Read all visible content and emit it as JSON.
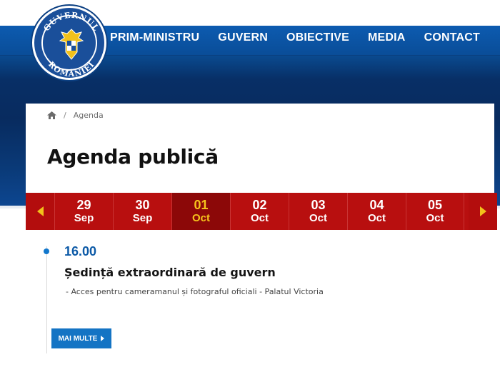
{
  "logo": {
    "ring_top": "GUVERNUL",
    "ring_bottom": "ROMÂNIEI"
  },
  "nav": {
    "items": [
      {
        "label": "PRIM-MINISTRU"
      },
      {
        "label": "GUVERN"
      },
      {
        "label": "OBIECTIVE"
      },
      {
        "label": "MEDIA"
      },
      {
        "label": "CONTACT"
      }
    ]
  },
  "breadcrumb": {
    "separator": "/",
    "current": "Agenda"
  },
  "page": {
    "title": "Agenda publică"
  },
  "dates": {
    "days": [
      {
        "num": "29",
        "mon": "Sep"
      },
      {
        "num": "30",
        "mon": "Sep"
      },
      {
        "num": "01",
        "mon": "Oct"
      },
      {
        "num": "02",
        "mon": "Oct"
      },
      {
        "num": "03",
        "mon": "Oct"
      },
      {
        "num": "04",
        "mon": "Oct"
      },
      {
        "num": "05",
        "mon": "Oct"
      }
    ],
    "active_index": 2
  },
  "event": {
    "time": "16.00",
    "title": "Ședință extraordinară de guvern",
    "description": "- Acces pentru cameramanul și fotograful oficiali - Palatul Victoria",
    "more_label": "MAI MULTE"
  },
  "colors": {
    "nav_blue": "#0b56a3",
    "date_red": "#b80f0f",
    "active_day_text": "#f6c41c",
    "accent_blue": "#1474c4"
  }
}
